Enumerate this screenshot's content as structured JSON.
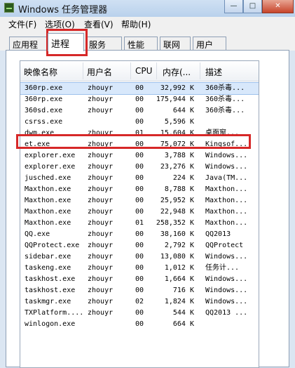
{
  "window": {
    "title": "Windows 任务管理器"
  },
  "menu": {
    "file": "文件(F)",
    "options": "选项(O)",
    "view": "查看(V)",
    "help": "帮助(H)"
  },
  "tabs": {
    "apps": "应用程序",
    "processes": "进程",
    "services": "服务",
    "performance": "性能",
    "network": "联网",
    "users": "用户"
  },
  "columns": {
    "name": "映像名称",
    "user": "用户名",
    "cpu": "CPU",
    "memory": "内存(...",
    "description": "描述"
  },
  "processes": [
    {
      "name": "360rp.exe",
      "user": "zhouyr",
      "cpu": "00",
      "mem": "32,992 K",
      "desc": "360杀毒..."
    },
    {
      "name": "360rp.exe",
      "user": "zhouyr",
      "cpu": "00",
      "mem": "175,944 K",
      "desc": "360杀毒..."
    },
    {
      "name": "360sd.exe",
      "user": "zhouyr",
      "cpu": "00",
      "mem": "644 K",
      "desc": "360杀毒..."
    },
    {
      "name": "csrss.exe",
      "user": "",
      "cpu": "00",
      "mem": "5,596 K",
      "desc": ""
    },
    {
      "name": "dwm.exe",
      "user": "zhouyr",
      "cpu": "01",
      "mem": "15,604 K",
      "desc": "桌面窗..."
    },
    {
      "name": "et.exe",
      "user": "zhouyr",
      "cpu": "00",
      "mem": "75,072 K",
      "desc": "Kingsof..."
    },
    {
      "name": "explorer.exe",
      "user": "zhouyr",
      "cpu": "00",
      "mem": "3,788 K",
      "desc": "Windows..."
    },
    {
      "name": "explorer.exe",
      "user": "zhouyr",
      "cpu": "00",
      "mem": "23,276 K",
      "desc": "Windows..."
    },
    {
      "name": "jusched.exe",
      "user": "zhouyr",
      "cpu": "00",
      "mem": "224 K",
      "desc": "Java(TM..."
    },
    {
      "name": "Maxthon.exe",
      "user": "zhouyr",
      "cpu": "00",
      "mem": "8,788 K",
      "desc": "Maxthon..."
    },
    {
      "name": "Maxthon.exe",
      "user": "zhouyr",
      "cpu": "00",
      "mem": "25,952 K",
      "desc": "Maxthon..."
    },
    {
      "name": "Maxthon.exe",
      "user": "zhouyr",
      "cpu": "00",
      "mem": "22,948 K",
      "desc": "Maxthon..."
    },
    {
      "name": "Maxthon.exe",
      "user": "zhouyr",
      "cpu": "01",
      "mem": "258,352 K",
      "desc": "Maxthon..."
    },
    {
      "name": "QQ.exe",
      "user": "zhouyr",
      "cpu": "00",
      "mem": "38,160 K",
      "desc": "QQ2013"
    },
    {
      "name": "QQProtect.exe",
      "user": "zhouyr",
      "cpu": "00",
      "mem": "2,792 K",
      "desc": "QQProtect"
    },
    {
      "name": "sidebar.exe",
      "user": "zhouyr",
      "cpu": "00",
      "mem": "13,080 K",
      "desc": "Windows..."
    },
    {
      "name": "taskeng.exe",
      "user": "zhouyr",
      "cpu": "00",
      "mem": "1,012 K",
      "desc": "任务计..."
    },
    {
      "name": "taskhost.exe",
      "user": "zhouyr",
      "cpu": "00",
      "mem": "1,664 K",
      "desc": "Windows..."
    },
    {
      "name": "taskhost.exe",
      "user": "zhouyr",
      "cpu": "00",
      "mem": "716 K",
      "desc": "Windows..."
    },
    {
      "name": "taskmgr.exe",
      "user": "zhouyr",
      "cpu": "02",
      "mem": "1,824 K",
      "desc": "Windows..."
    },
    {
      "name": "TXPlatform....",
      "user": "zhouyr",
      "cpu": "00",
      "mem": "544 K",
      "desc": "QQ2013 ..."
    },
    {
      "name": "winlogon.exe",
      "user": "",
      "cpu": "00",
      "mem": "664 K",
      "desc": ""
    }
  ],
  "selected_row": 0,
  "highlighted_row": 5,
  "colors": {
    "highlight": "#d62828",
    "selection": "#d8e8fb"
  }
}
